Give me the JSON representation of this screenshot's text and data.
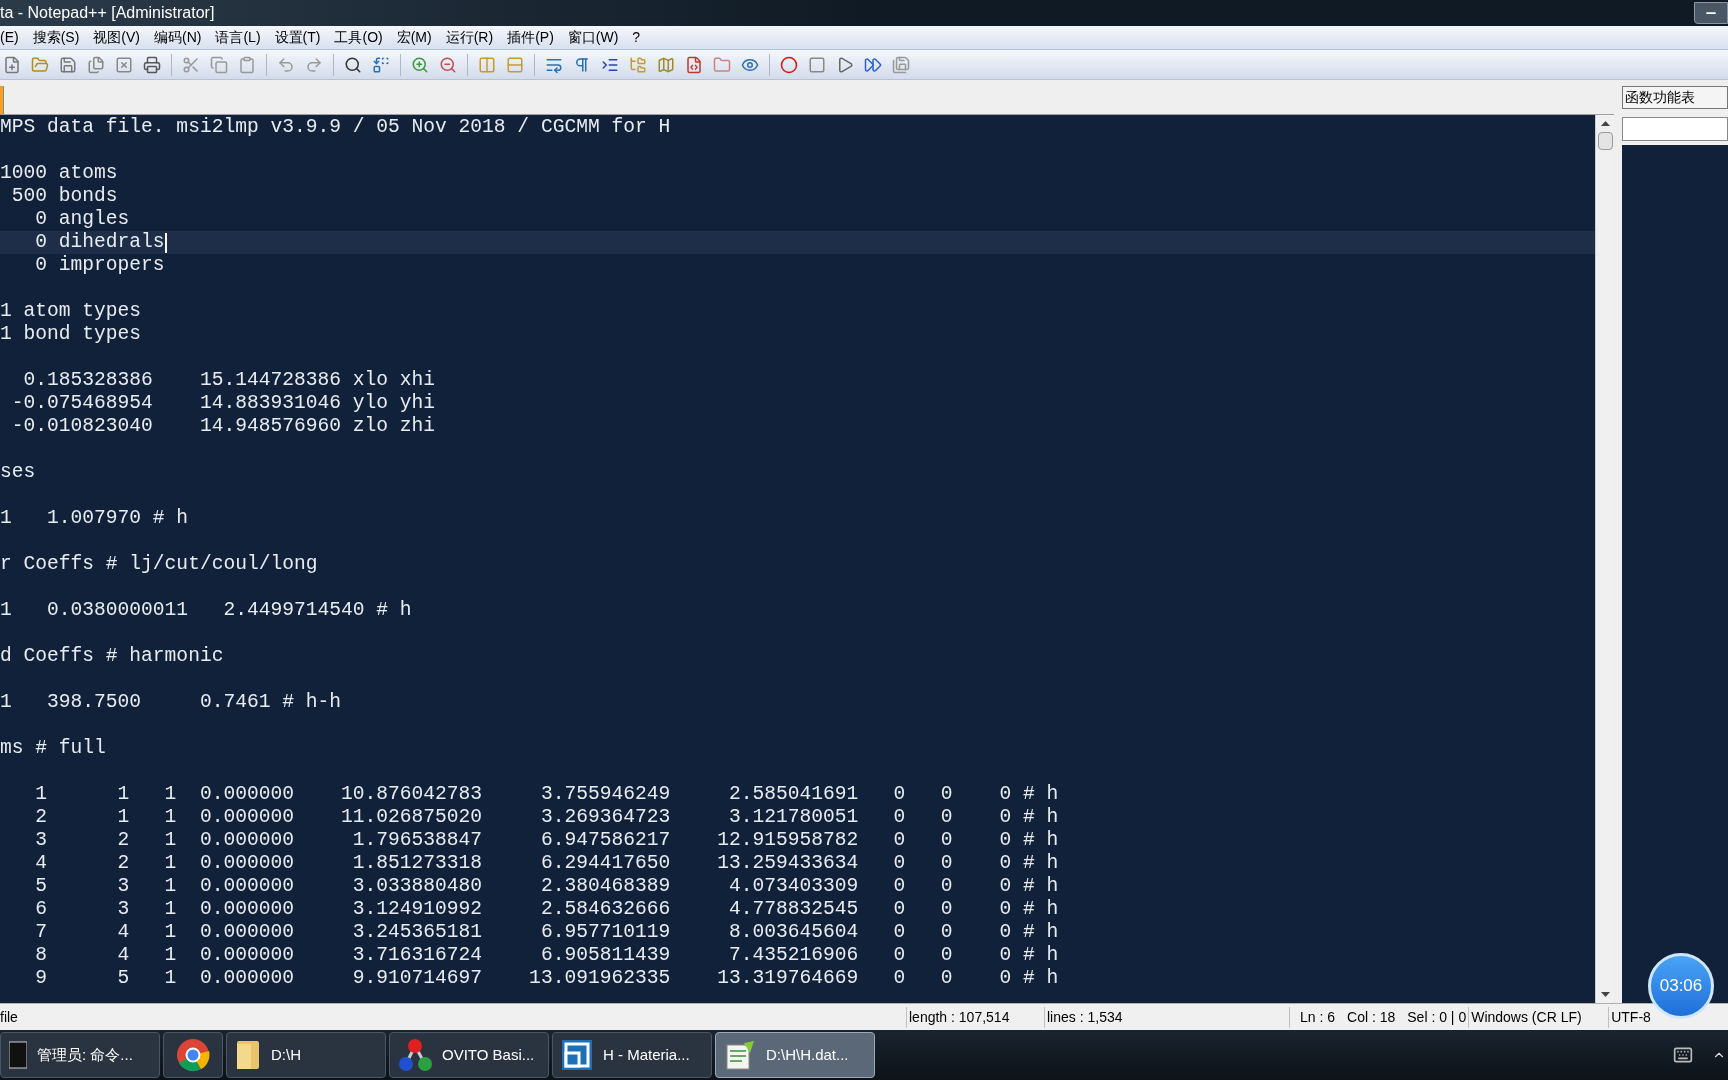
{
  "window": {
    "title": "ta - Notepad++ [Administrator]"
  },
  "menu": [
    "(E)",
    "搜索(S)",
    "视图(V)",
    "编码(N)",
    "语言(L)",
    "设置(T)",
    "工具(O)",
    "宏(M)",
    "运行(R)",
    "插件(P)",
    "窗口(W)",
    "?"
  ],
  "editor": {
    "lines": [
      {
        "text": "MPS data file. msi2lmp v3.9.9 / 05 Nov 2018 / CGCMM for H",
        "current": false
      },
      {
        "current": false
      },
      {
        "text": "1000 atoms",
        "current": false
      },
      {
        "text": " 500 bonds",
        "current": false
      },
      {
        "text": "   0 angles",
        "current": false
      },
      {
        "text": "   0 dihedrals",
        "current": true
      },
      {
        "text": "   0 impropers",
        "current": false
      },
      {
        "current": false
      },
      {
        "text": "1 atom types",
        "current": false
      },
      {
        "text": "1 bond types",
        "current": false
      },
      {
        "current": false
      },
      {
        "text": "  0.185328386    15.144728386 xlo xhi",
        "current": false
      },
      {
        "text": " -0.075468954    14.883931046 ylo yhi",
        "current": false
      },
      {
        "text": " -0.010823040    14.948576960 zlo zhi",
        "current": false
      },
      {
        "current": false
      },
      {
        "text": "ses",
        "current": false
      },
      {
        "current": false
      },
      {
        "text": "1   1.007970 # h",
        "current": false
      },
      {
        "current": false
      },
      {
        "text": "r Coeffs # lj/cut/coul/long",
        "current": false
      },
      {
        "current": false
      },
      {
        "text": "1   0.0380000011   2.4499714540 # h",
        "current": false
      },
      {
        "current": false
      },
      {
        "text": "d Coeffs # harmonic",
        "current": false
      },
      {
        "current": false
      },
      {
        "text": "1   398.7500     0.7461 # h-h",
        "current": false
      },
      {
        "current": false
      },
      {
        "text": "ms # full",
        "current": false
      },
      {
        "current": false
      },
      {
        "text": "   1      1   1  0.000000    10.876042783     3.755946249     2.585041691   0   0    0 # h",
        "current": false
      },
      {
        "text": "   2      1   1  0.000000    11.026875020     3.269364723     3.121780051   0   0    0 # h",
        "current": false
      },
      {
        "text": "   3      2   1  0.000000     1.796538847     6.947586217    12.915958782   0   0    0 # h",
        "current": false
      },
      {
        "text": "   4      2   1  0.000000     1.851273318     6.294417650    13.259433634   0   0    0 # h",
        "current": false
      },
      {
        "text": "   5      3   1  0.000000     3.033880480     2.380468389     4.073403309   0   0    0 # h",
        "current": false
      },
      {
        "text": "   6      3   1  0.000000     3.124910992     2.584632666     4.778832545   0   0    0 # h",
        "current": false
      },
      {
        "text": "   7      4   1  0.000000     3.245365181     6.957710119     8.003645604   0   0    0 # h",
        "current": false
      },
      {
        "text": "   8      4   1  0.000000     3.716316724     6.905811439     7.435216906   0   0    0 # h",
        "current": false
      },
      {
        "text": "   9      5   1  0.000000     9.910714697    13.091962335    13.319764669   0   0    0 # h",
        "current": false
      }
    ]
  },
  "function_list": {
    "title": "函数功能表"
  },
  "status_bar": {
    "left": "file",
    "items": [
      "length : 107,514",
      "lines : 1,534",
      "Ln : 6",
      "Col : 18",
      "Sel : 0 | 0",
      "Windows (CR LF)",
      "UTF-8"
    ]
  },
  "timer": "03:06",
  "taskbar": {
    "items": [
      {
        "kind": "terminal",
        "label": "管理员: 命令...",
        "selected": false
      },
      {
        "kind": "browser",
        "selected": false
      },
      {
        "kind": "folder",
        "label": "D:\\H",
        "selected": false
      },
      {
        "kind": "ovito",
        "label": "OVITO Basi...",
        "selected": false
      },
      {
        "kind": "materials",
        "label": "H - Materia...",
        "selected": false
      },
      {
        "kind": "notepad",
        "label": "D:\\H\\H.dat...",
        "selected": true
      }
    ]
  }
}
